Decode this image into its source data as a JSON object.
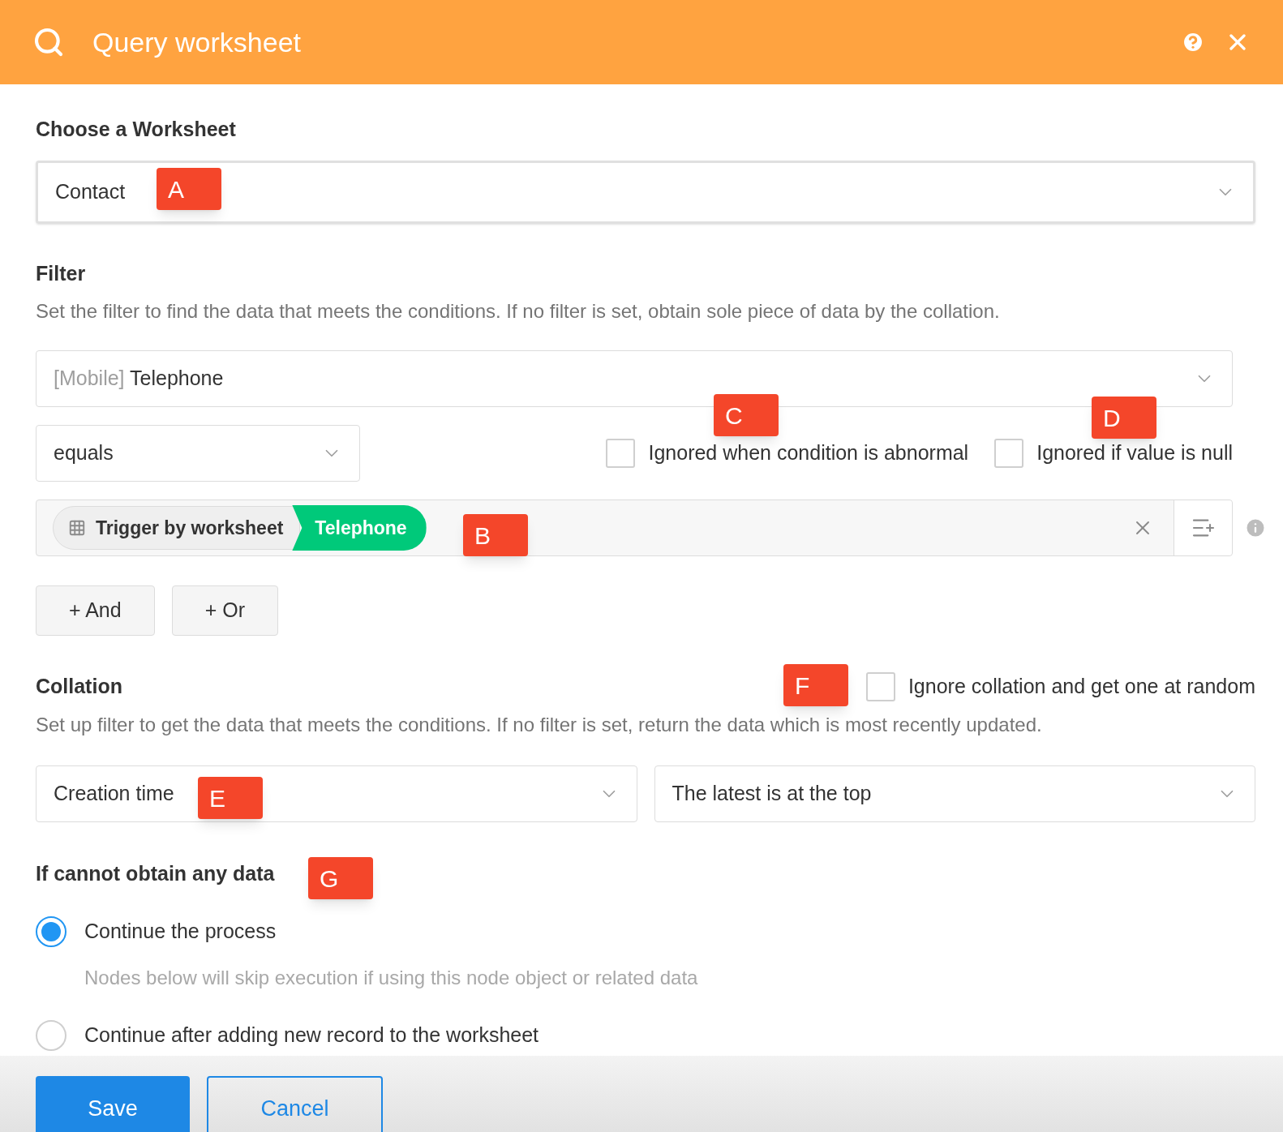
{
  "header": {
    "title": "Query worksheet"
  },
  "worksheet": {
    "heading": "Choose a Worksheet",
    "value": "Contact"
  },
  "filter": {
    "heading": "Filter",
    "description": "Set the filter to find the data that meets the conditions. If no filter is set, obtain sole piece of data by the collation.",
    "field": {
      "prefix": "[Mobile]",
      "value": "Telephone"
    },
    "operator": "equals",
    "options": [
      {
        "label": "Ignored when condition is abnormal",
        "checked": false
      },
      {
        "label": "Ignored if value is null",
        "checked": false
      }
    ],
    "value_tags": [
      {
        "label": "Trigger by worksheet",
        "kind": "source"
      },
      {
        "label": "Telephone",
        "kind": "field"
      }
    ],
    "add_buttons": [
      "+ And",
      "+ Or"
    ]
  },
  "collation": {
    "heading": "Collation",
    "random": {
      "label": "Ignore collation and get one at random",
      "checked": false
    },
    "description": "Set up filter to get the data that meets the conditions. If no filter is set, return the data which is most recently updated.",
    "field": "Creation time",
    "order": "The latest is at the top"
  },
  "fallback": {
    "heading": "If cannot obtain any data",
    "options": [
      {
        "label": "Continue the process",
        "hint": "Nodes below will skip execution if using this node object or related data",
        "selected": true
      },
      {
        "label": "Continue after adding new record to the worksheet",
        "selected": false
      }
    ]
  },
  "annotations": [
    {
      "label": "A"
    },
    {
      "label": "C"
    },
    {
      "label": "D"
    },
    {
      "label": "B"
    },
    {
      "label": "F"
    },
    {
      "label": "E"
    },
    {
      "label": "G"
    }
  ],
  "buttons": [
    {
      "label": "Save",
      "kind": "primary"
    },
    {
      "label": "Cancel",
      "kind": "secondary"
    }
  ]
}
